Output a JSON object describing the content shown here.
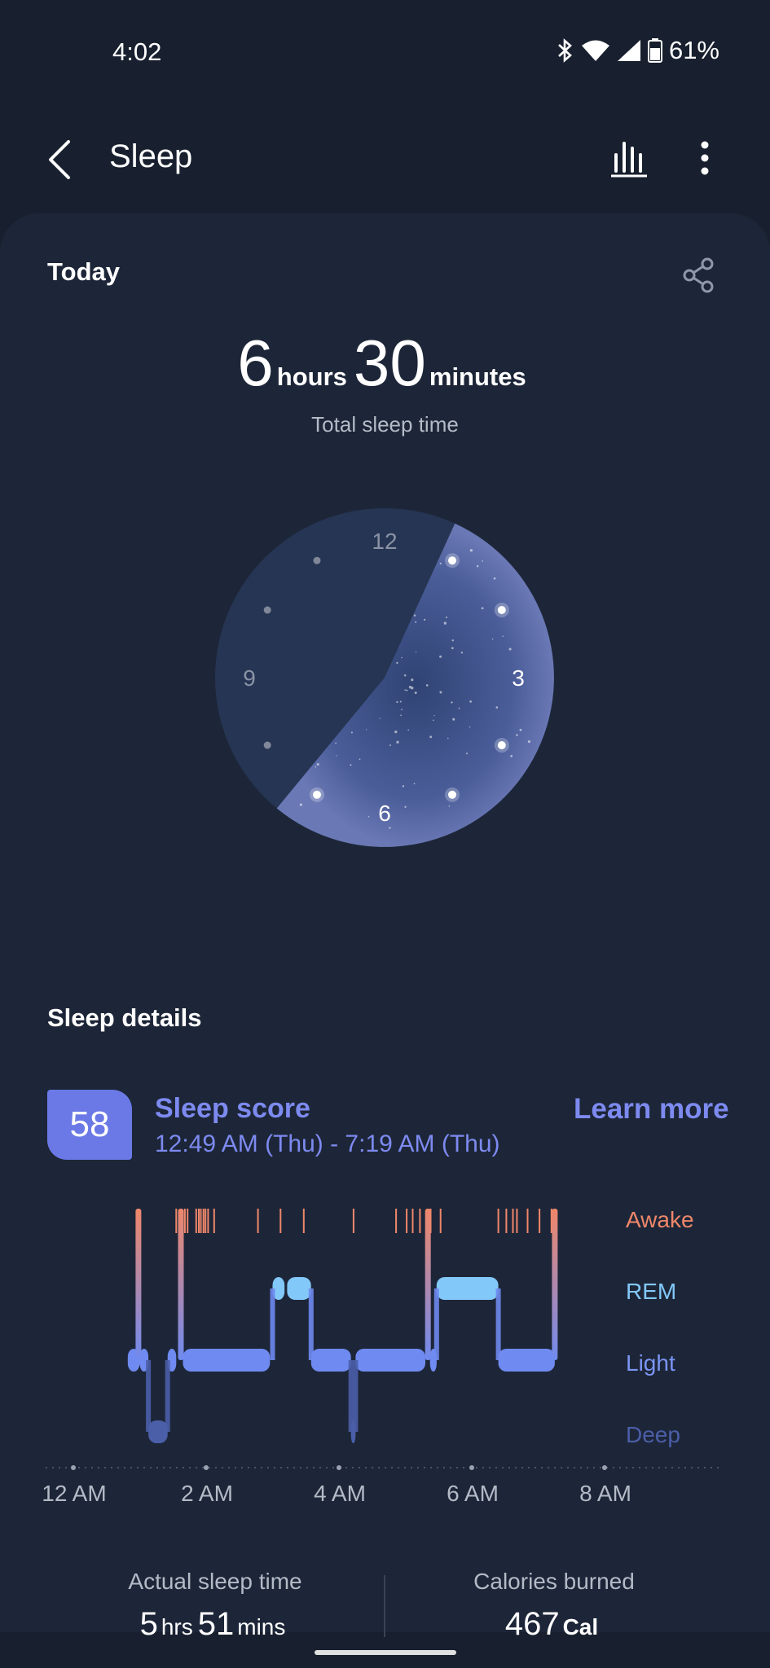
{
  "status_bar": {
    "time": "4:02",
    "battery": "61%"
  },
  "app_bar": {
    "title": "Sleep",
    "back_icon": "chevron-left-icon",
    "chart_icon": "bar-chart-icon",
    "more_icon": "more-vertical-icon"
  },
  "today": {
    "label": "Today",
    "share_icon": "share-icon",
    "hours": "6",
    "hours_unit": "hours",
    "minutes": "30",
    "minutes_unit": "minutes",
    "total_label": "Total sleep time"
  },
  "clock": {
    "labels": [
      "12",
      "3",
      "6",
      "9"
    ],
    "sleep_start": "12:49 AM",
    "sleep_end": "7:19 AM"
  },
  "details": {
    "label": "Sleep details",
    "score": "58",
    "score_title": "Sleep score",
    "score_range": "12:49 AM (Thu) - 7:19 AM (Thu)",
    "learn_more": "Learn more"
  },
  "chart_data": {
    "type": "step",
    "y_categories": [
      "Awake",
      "REM",
      "Light",
      "Deep"
    ],
    "x_ticks": [
      "12 AM",
      "2 AM",
      "4 AM",
      "6 AM",
      "8 AM"
    ],
    "x_range_hours": [
      0,
      8
    ],
    "segments": [
      {
        "start": 0.82,
        "end": 1.0,
        "stage": "Light"
      },
      {
        "start": 1.0,
        "end": 1.13,
        "stage": "Light"
      },
      {
        "start": 1.13,
        "end": 1.42,
        "stage": "Deep"
      },
      {
        "start": 1.42,
        "end": 1.55,
        "stage": "Light"
      },
      {
        "start": 1.65,
        "end": 2.96,
        "stage": "Light"
      },
      {
        "start": 3.0,
        "end": 3.18,
        "stage": "REM"
      },
      {
        "start": 3.22,
        "end": 3.58,
        "stage": "REM"
      },
      {
        "start": 3.58,
        "end": 4.18,
        "stage": "Light"
      },
      {
        "start": 4.18,
        "end": 4.25,
        "stage": "Deep"
      },
      {
        "start": 4.25,
        "end": 5.3,
        "stage": "Light"
      },
      {
        "start": 5.37,
        "end": 5.47,
        "stage": "Light"
      },
      {
        "start": 5.47,
        "end": 6.4,
        "stage": "REM"
      },
      {
        "start": 6.4,
        "end": 7.25,
        "stage": "Light"
      }
    ],
    "awake_markers": [
      0.98,
      1.55,
      1.62,
      1.68,
      1.72,
      1.85,
      1.89,
      1.92,
      1.96,
      1.99,
      2.03,
      2.12,
      2.78,
      3.12,
      3.47,
      4.22,
      4.86,
      5.02,
      5.11,
      5.22,
      5.34,
      5.38,
      5.53,
      6.4,
      6.52,
      6.62,
      6.68,
      6.84,
      7.02,
      7.2,
      7.25
    ],
    "awake_heavy": [
      0.98,
      1.62,
      5.34,
      7.25
    ]
  },
  "stats": {
    "actual_title": "Actual sleep time",
    "actual_hrs": "5",
    "actual_hrs_unit": "hrs",
    "actual_mins": "51",
    "actual_mins_unit": "mins",
    "calories_title": "Calories burned",
    "calories_value": "467",
    "calories_unit": "Cal"
  },
  "colors": {
    "background": "#18202f",
    "card": "#1d2638",
    "accent": "#6b79e6",
    "awake": "#f0876a",
    "rem": "#82c8f8",
    "light": "#6f8af0",
    "deep": "#4b5ea8"
  }
}
